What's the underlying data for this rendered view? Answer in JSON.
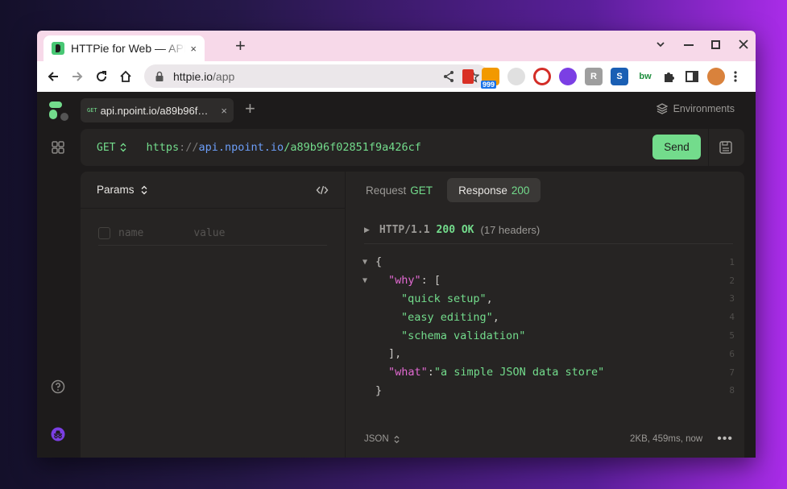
{
  "browser": {
    "tab_title": "HTTPie for Web — API testing client",
    "tab_close": "×",
    "new_tab": "+",
    "url_host": "httpie.io",
    "url_path": "/app",
    "extensions": [
      {
        "name": "book-extension",
        "color": "#d93025",
        "text": ""
      },
      {
        "name": "rss-extension",
        "color": "#f29900",
        "text": "",
        "badge": "999"
      },
      {
        "name": "moon-extension",
        "color": "#c7c7c7",
        "text": ""
      },
      {
        "name": "lastpass-extension",
        "color": "#d32d27",
        "text": ""
      },
      {
        "name": "circle-extension",
        "color": "#7b3fe4",
        "text": ""
      },
      {
        "name": "r-extension",
        "color": "#9e9e9e",
        "text": "R"
      },
      {
        "name": "s-extension",
        "color": "#1a5fb4",
        "text": "S"
      },
      {
        "name": "bw-extension",
        "color": "#ffffff",
        "text": "bw"
      }
    ]
  },
  "app": {
    "tab": {
      "method": "GET",
      "label": "api.npoint.io/a89b96f…",
      "close": "×"
    },
    "new_tab": "+",
    "environments": "Environments",
    "request": {
      "method": "GET",
      "url_scheme": "https",
      "url_sep": "://",
      "url_host": "api.npoint.io",
      "url_path": "/a89b96f02851f9a426cf",
      "send_label": "Send"
    },
    "params": {
      "title": "Params",
      "name_placeholder": "name",
      "value_placeholder": "value"
    },
    "response_tabs": [
      {
        "label": "Request",
        "tag": "GET"
      },
      {
        "label": "Response",
        "tag": "200"
      }
    ],
    "status": {
      "protocol": "HTTP/1.1",
      "code": "200 OK",
      "headers": "(17 headers)"
    },
    "json_lines": [
      {
        "num": "1"
      },
      {
        "num": "2"
      },
      {
        "num": "3"
      },
      {
        "num": "4"
      },
      {
        "num": "5"
      },
      {
        "num": "6"
      },
      {
        "num": "7"
      },
      {
        "num": "8"
      }
    ],
    "json": {
      "key_why": "\"why\"",
      "v1": "\"quick setup\"",
      "v2": "\"easy editing\"",
      "v3": "\"schema validation\"",
      "key_what": "\"what\"",
      "what_val": "\"a simple JSON data store\""
    },
    "footer": {
      "format": "JSON",
      "meta": "2KB, 459ms, now",
      "more": "•••"
    }
  }
}
